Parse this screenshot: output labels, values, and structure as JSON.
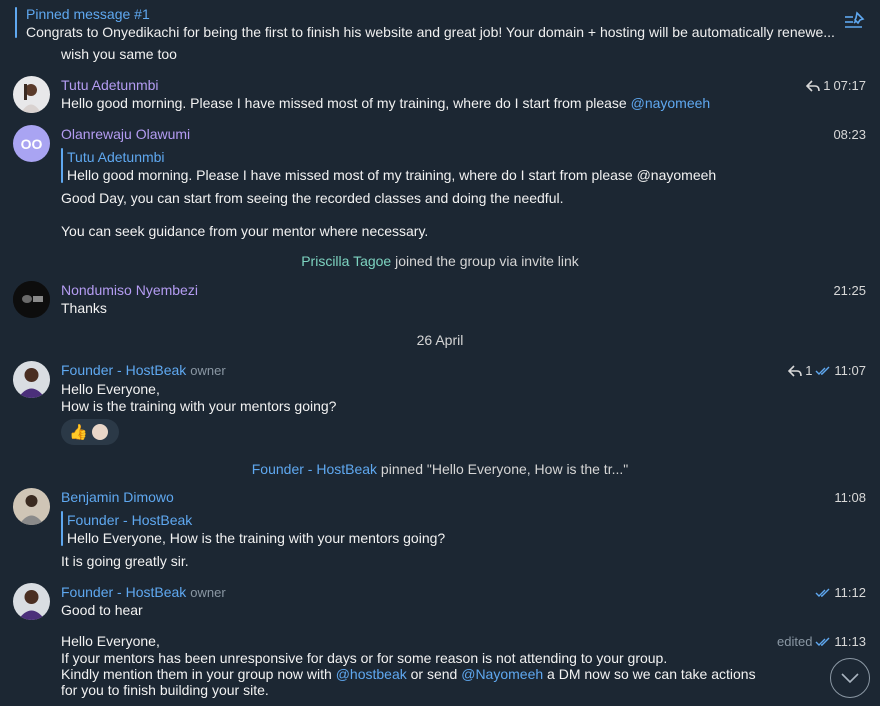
{
  "pinned": {
    "title": "Pinned message #1",
    "text": "Congrats to Onyedikachi for being the first to finish his website and great job! Your domain + hosting will be automatically renewe..."
  },
  "colors": {
    "background": "#1c2733",
    "accent": "#5fa8f0",
    "name_purple": "#b49cf2",
    "service_name": "#7dd3c0"
  },
  "messages": {
    "m0": {
      "text": "wish you same too"
    },
    "m1": {
      "name": "Tutu Adetunmbi",
      "reply_count": "1",
      "time": "07:17",
      "text": "Hello good morning. Please I have missed most of my training, where do I start from please ",
      "mention": "@nayomeeh"
    },
    "m2": {
      "name": "Olanrewaju Olawumi",
      "initials": "OO",
      "time": "08:23",
      "reply_name": "Tutu Adetunmbi",
      "reply_text": "Hello good morning. Please I have missed most of my training, where do I start from please @nayomeeh",
      "text1": "Good Day, you can start from seeing the recorded classes and doing the needful.",
      "text2": "You can seek guidance from your mentor where necessary."
    },
    "join": {
      "name": "Priscilla Tagoe",
      "text": " joined the group via invite link"
    },
    "m3": {
      "name": "Nondumiso Nyembezi",
      "time": "21:25",
      "text": "Thanks"
    },
    "date": "26 April",
    "m4": {
      "name": "Founder - HostBeak",
      "role": "owner",
      "reply_count": "1",
      "time": "11:07",
      "text1": "Hello Everyone,",
      "text2": "How is the training with your mentors going?",
      "reactions": [
        "thumbs-up",
        "avatar"
      ]
    },
    "pin_event": {
      "name": "Founder - HostBeak",
      "text": " pinned \"Hello Everyone,  How is the tr...\""
    },
    "m5": {
      "name": "Benjamin Dimowo",
      "time": "11:08",
      "reply_name": "Founder - HostBeak",
      "reply_text": "Hello Everyone,  How is the training with your mentors going?",
      "text": "It is going greatly sir."
    },
    "m6": {
      "name": "Founder - HostBeak",
      "role": "owner",
      "time": "11:12",
      "text": "Good to hear"
    },
    "m7": {
      "edited": "edited",
      "time": "11:13",
      "line1": "Hello Everyone,",
      "line2": "If your mentors has been unresponsive for days or for some reason is not attending to your group.",
      "line3a": "Kindly mention them in your group now with ",
      "line3m1": "@hostbeak",
      "line3b": " or send ",
      "line3m2": "@Nayomeeh",
      "line3c": " a DM now so we can take actions",
      "line4": "for you to finish building your site."
    }
  }
}
